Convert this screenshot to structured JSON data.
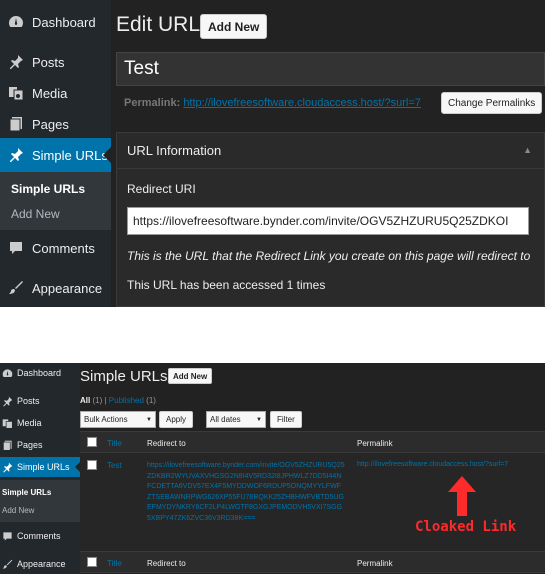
{
  "top": {
    "sidebar": {
      "items": [
        {
          "label": "Dashboard",
          "icon": "dashboard-icon"
        },
        {
          "label": "Posts",
          "icon": "pin-icon"
        },
        {
          "label": "Media",
          "icon": "media-icon"
        },
        {
          "label": "Pages",
          "icon": "pages-icon"
        },
        {
          "label": "Simple URLs",
          "icon": "pin-icon",
          "active": true
        },
        {
          "label": "Comments",
          "icon": "comment-icon"
        },
        {
          "label": "Appearance",
          "icon": "brush-icon"
        }
      ],
      "submenu": [
        "Simple URLs",
        "Add New"
      ]
    },
    "header": {
      "title": "Edit URL",
      "add_new": "Add New"
    },
    "post_title": "Test",
    "permalink": {
      "label": "Permalink:",
      "url": "http://ilovefreesoftware.cloudaccess.host/?surl=7",
      "change_button": "Change Permalinks"
    },
    "url_box": {
      "title": "URL Information",
      "field_label": "Redirect URI",
      "field_value": "https://ilovefreesoftware.bynder.com/invite/OGV5ZHZURU5Q25ZDKOI",
      "description": "This is the URL that the Redirect Link you create on this page will redirect to",
      "accessed": "This URL has been accessed 1 times"
    }
  },
  "bottom": {
    "sidebar": {
      "items": [
        {
          "label": "Dashboard"
        },
        {
          "label": "Posts"
        },
        {
          "label": "Media"
        },
        {
          "label": "Pages"
        },
        {
          "label": "Simple URLs",
          "active": true
        },
        {
          "label": "Comments"
        },
        {
          "label": "Appearance"
        }
      ],
      "submenu": [
        "Simple URLs",
        "Add New"
      ]
    },
    "header": {
      "title": "Simple URLs",
      "add_new": "Add New"
    },
    "filters": {
      "all": "All",
      "all_count": "(1)",
      "sep": "|",
      "published": "Published",
      "published_count": "(1)"
    },
    "bulk_actions": "Bulk Actions",
    "apply": "Apply",
    "dates": "All dates",
    "filter": "Filter",
    "columns": [
      "Title",
      "Redirect to",
      "Permalink"
    ],
    "rows": [
      {
        "title": "Test",
        "redirect": "https://ilovefreesoftware.bynder.com/invite/OGV5ZHZURU5Q25ZDKBR2WYUVAXVHGSG2N8I4V5RD32I8JPHWLZ7DD5I44NFCDETTA6VDV57EX4F5MYDDWOF6RDUP5ONQMYYLFWFZTSEBAWNRPWG626XP55FU78RQKK25ZHBHWFVBTD5UGEFMYDYNKRY6CF2LP4LWGTF8GXGJPEMODVH5VXI7SGG5XBPY47ZK6ZVC36V3RD38K===",
        "permalink": "http://ilovefreesoftware.cloudaccess.host/?surl=7"
      }
    ],
    "annotation": "Cloaked Link",
    "annotation_color": "#ff2a2a"
  },
  "colors": {
    "accent": "#0073aa",
    "sidebar": "#23282d",
    "background": "#222222"
  }
}
